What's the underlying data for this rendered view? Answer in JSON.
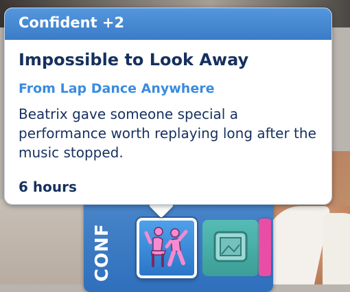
{
  "tooltip": {
    "header": "Confident +2",
    "title": "Impossible to Look Away",
    "source": "From Lap Dance Anywhere",
    "description": "Beatrix gave someone special a performance worth replaying long after the music stopped.",
    "duration": "6 hours"
  },
  "moodlet_panel": {
    "label": "CONF",
    "active_icon": "dancing-couple-icon",
    "other_icon": "picture-frame-icon",
    "bar_color": "#e94ea6"
  },
  "colors": {
    "header_blue": "#3a7cc7",
    "title_navy": "#16305e",
    "source_blue": "#3a8be0"
  }
}
